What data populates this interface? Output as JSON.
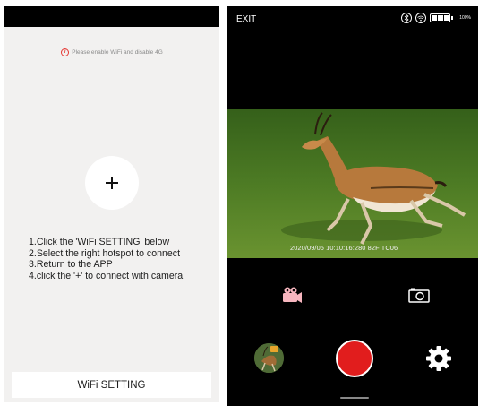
{
  "left_screen": {
    "warning_icon": "info-icon",
    "warning_text": "Please enable WiFi and disable 4G",
    "add_icon": "plus-icon",
    "instructions": [
      "1.Click the 'WiFi SETTING' below",
      "2.Select the right hotspot to connect",
      "3.Return to the APP",
      "4.click the '+' to connect with camera"
    ],
    "wifi_button_label": "WiFi SETTING"
  },
  "right_screen": {
    "exit_label": "EXIT",
    "status_icons": [
      "bluetooth-icon",
      "wifi-icon",
      "battery-icon"
    ],
    "battery_percent": "100%",
    "photo_timestamp": "2020/09/05 10:10:16:280 82F TC06",
    "controls": {
      "video_icon": "video-camera-icon",
      "photo_icon": "camera-icon",
      "gallery_icon": "gallery-thumbnail",
      "shutter_icon": "record-button",
      "settings_icon": "gear-icon"
    }
  },
  "colors": {
    "accent_red": "#e11d1d",
    "video_icon_pink": "#f7b6bf",
    "warning_red": "#e53935"
  }
}
